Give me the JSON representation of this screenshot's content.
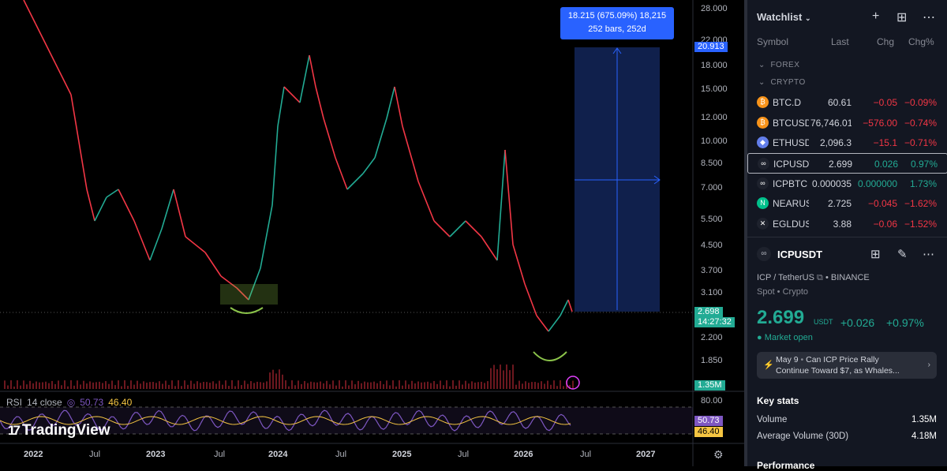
{
  "chart": {
    "price_axis": [
      "28.000",
      "22.000",
      "18.000",
      "15.000",
      "12.000",
      "10.000",
      "8.500",
      "7.000",
      "5.500",
      "4.500",
      "3.700",
      "3.100",
      "2.200",
      "1.850"
    ],
    "time_axis": [
      {
        "label": "2022",
        "year": true
      },
      {
        "label": "Jul",
        "year": false
      },
      {
        "label": "2023",
        "year": true
      },
      {
        "label": "Jul",
        "year": false
      },
      {
        "label": "2024",
        "year": true
      },
      {
        "label": "Jul",
        "year": false
      },
      {
        "label": "2025",
        "year": true
      },
      {
        "label": "Jul",
        "year": false
      },
      {
        "label": "2026",
        "year": true
      },
      {
        "label": "Jul",
        "year": false
      },
      {
        "label": "2027",
        "year": true
      }
    ],
    "measure": {
      "line1": "18.215 (675.09%) 18,215",
      "line2": "252 bars, 252d"
    },
    "labels": {
      "target": "20.913",
      "current": "2.698",
      "countdown": "14:27:32",
      "volume": "1.35M",
      "rsi_1": "50.73",
      "rsi_2": "46.40"
    },
    "rsi_axis": "80.00",
    "rsi_legend": {
      "name": "RSI",
      "params": "14 close",
      "v1": "50.73",
      "v2": "46.40"
    },
    "brand": "TradingView",
    "colors": {
      "up": "#22ab94",
      "down": "#f23645",
      "rsi": "#7e57c2",
      "rsi_ma": "#f5c542",
      "measure": "#2962ff",
      "highlight": "#8bc34a"
    }
  },
  "watchlist": {
    "title": "Watchlist",
    "columns": {
      "symbol": "Symbol",
      "last": "Last",
      "chg": "Chg",
      "chgp": "Chg%"
    },
    "sections": {
      "forex": "FOREX",
      "crypto": "CRYPTO"
    },
    "rows": [
      {
        "sym": "BTC.D",
        "last": "60.61",
        "chg": "−0.05",
        "chgp": "−0.09%",
        "dir": "neg",
        "icon": "bitcoin-icon",
        "icon_color": "#f7931a",
        "glyph": "₿"
      },
      {
        "sym": "BTCUSDT",
        "last": "76,746.01",
        "chg": "−576.00",
        "chgp": "−0.74%",
        "dir": "neg",
        "icon": "bitcoin-icon",
        "icon_color": "#f7931a",
        "glyph": "₿"
      },
      {
        "sym": "ETHUSDT",
        "last": "2,096.3",
        "chg": "−15.1",
        "chgp": "−0.71%",
        "dir": "neg",
        "icon": "ethereum-icon",
        "icon_color": "#627eea",
        "glyph": "◆"
      },
      {
        "sym": "ICPUSDT",
        "last": "2.699",
        "chg": "0.026",
        "chgp": "0.97%",
        "dir": "pos",
        "icon": "icp-icon",
        "icon_color": "#1e222d",
        "glyph": "∞"
      },
      {
        "sym": "ICPBTC",
        "last": "0.000035",
        "chg": "0.000000",
        "chgp": "1.73%",
        "dir": "pos",
        "icon": "icp-icon",
        "icon_color": "#1e222d",
        "glyph": "∞"
      },
      {
        "sym": "NEARUSDT",
        "last": "2.725",
        "chg": "−0.045",
        "chgp": "−1.62%",
        "dir": "neg",
        "icon": "near-icon",
        "icon_color": "#00c08b",
        "glyph": "N"
      },
      {
        "sym": "EGLDUSDT",
        "last": "3.88",
        "chg": "−0.06",
        "chgp": "−1.52%",
        "dir": "neg",
        "icon": "egld-icon",
        "icon_color": "#1e222d",
        "glyph": "✕"
      }
    ],
    "selected_index": 3
  },
  "detail": {
    "symbol": "ICPUSDT",
    "description": "ICP / TetherUS",
    "exchange": "BINANCE",
    "type": "Spot • Crypto",
    "price": "2.699",
    "currency": "USDT",
    "change": "+0.026",
    "change_pct": "+0.97%",
    "status": "Market open",
    "news": {
      "date": "May 9",
      "line1": "Can ICP Price Rally",
      "line2": "Continue Toward $7, as Whales..."
    },
    "key_stats_title": "Key stats",
    "stats": [
      {
        "k": "Volume",
        "v": "1.35M"
      },
      {
        "k": "Average Volume (30D)",
        "v": "4.18M"
      }
    ],
    "performance_title": "Performance"
  }
}
